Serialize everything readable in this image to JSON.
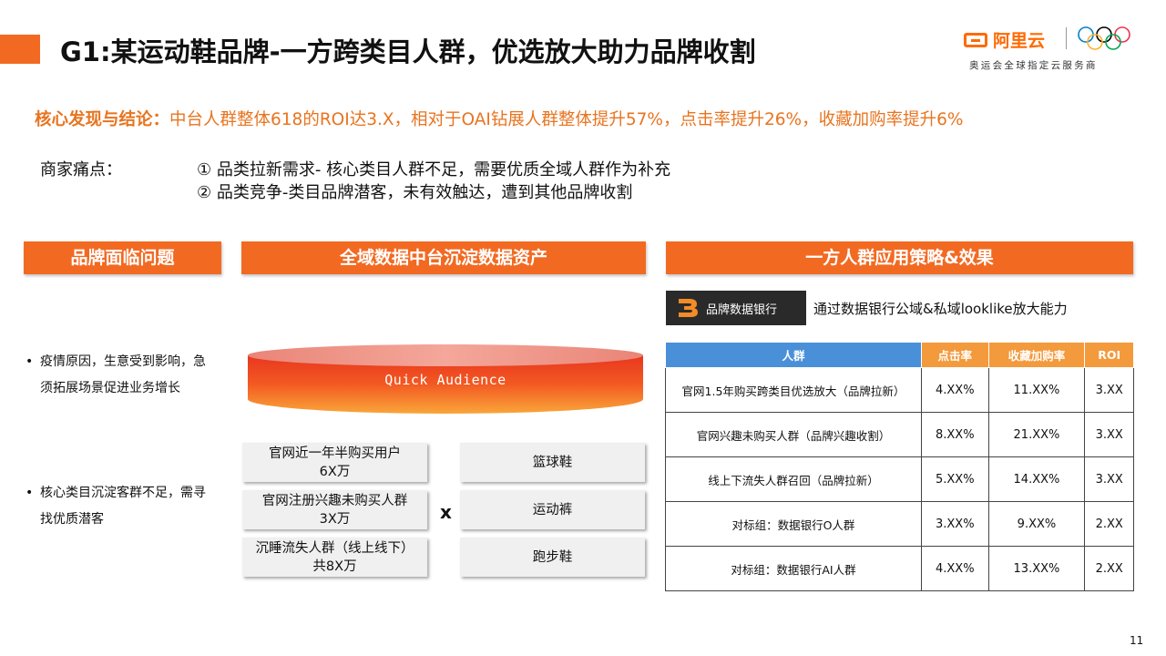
{
  "header": {
    "title": "G1:某运动鞋品牌-一方跨类目人群，优选放大助力品牌收割",
    "logo_brand": "阿里云",
    "logo_sub": "奥运会全球指定云服务商"
  },
  "finding": {
    "label": "核心发现与结论：",
    "text": "中台人群整体618的ROI达3.X，相对于OAI钻展人群整体提升57%，点击率提升26%，收藏加购率提升6%"
  },
  "pain_points": {
    "label": "商家痛点：",
    "items": [
      "① 品类拉新需求- 核心类目人群不足，需要优质全域人群作为补充",
      "② 品类竞争-类目品牌潜客，未有效触达，遭到其他品牌收割"
    ]
  },
  "sections": {
    "left": "品牌面临问题",
    "middle": "全域数据中台沉淀数据资产",
    "right": "一方人群应用策略&效果"
  },
  "left_bullets": [
    "疫情原因，生意受到影响，急须拓展场景促进业务增长",
    "核心类目沉淀客群不足，需寻找优质潜客"
  ],
  "middle": {
    "cylinder_label": "Quick Audience",
    "audience_boxes": [
      {
        "line1": "官网近一年半购买用户",
        "line2": "6X万"
      },
      {
        "line1": "官网注册兴趣未购买人群",
        "line2": "3X万"
      },
      {
        "line1": "沉睡流失人群（线上线下）",
        "line2": "共8X万"
      }
    ],
    "times_sign": "x",
    "category_boxes": [
      "篮球鞋",
      "运动裤",
      "跑步鞋"
    ]
  },
  "right": {
    "bank_label": "品牌数据银行",
    "bank_desc": "通过数据银行公域&私域looklike放大能力",
    "table": {
      "headers": [
        "人群",
        "点击率",
        "收藏加购率",
        "ROI"
      ],
      "rows": [
        [
          "官网1.5年购买跨类目优选放大（品牌拉新）",
          "4.XX%",
          "11.XX%",
          "3.XX"
        ],
        [
          "官网兴趣未购买人群（品牌兴趣收割）",
          "8.XX%",
          "21.XX%",
          "3.XX"
        ],
        [
          "线上下流失人群召回（品牌拉新）",
          "5.XX%",
          "14.XX%",
          "3.XX"
        ],
        [
          "对标组：数据银行O人群",
          "3.XX%",
          "9.XX%",
          "2.XX"
        ],
        [
          "对标组：数据银行AI人群",
          "4.XX%",
          "13.XX%",
          "2.XX"
        ]
      ]
    }
  },
  "page_number": "11",
  "colors": {
    "accent": "#f26a22",
    "finding_text": "#e8741f",
    "table_header_blue": "#4a90d9",
    "table_header_orange": "#f39a3c"
  }
}
